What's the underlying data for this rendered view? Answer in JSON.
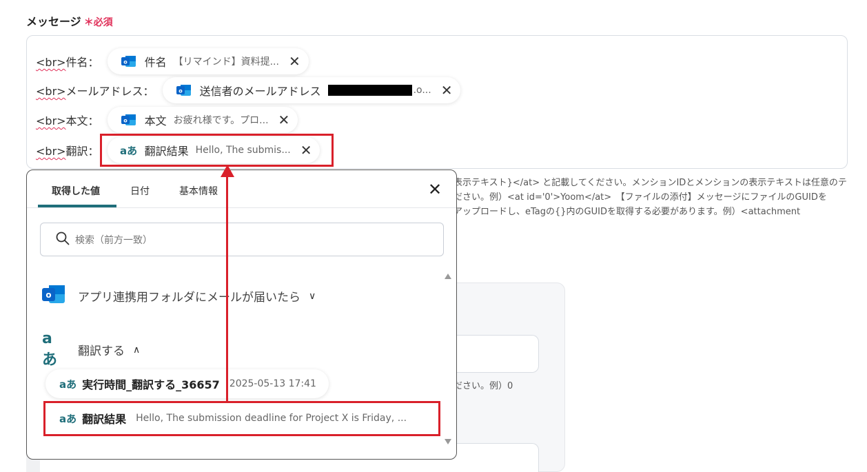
{
  "field": {
    "label": "メッセージ",
    "required_mark": "＊",
    "required_text": "必須"
  },
  "editor_rows": [
    {
      "prefix_tag": "<br>",
      "prefix_text": "件名：",
      "chip_name": "件名",
      "chip_value": "【リマインド】資料提...",
      "chip_icon": "outlook-icon"
    },
    {
      "prefix_tag": "<br>",
      "prefix_text": "メールアドレス：",
      "chip_name": "送信者のメールアドレス",
      "chip_value": ".o...",
      "chip_icon": "outlook-icon"
    },
    {
      "prefix_tag": "<br>",
      "prefix_text": "本文：",
      "chip_name": "本文",
      "chip_value": "お疲れ様です。プロ...",
      "chip_icon": "outlook-icon"
    },
    {
      "prefix_tag": "<br>",
      "prefix_text": "翻訳：",
      "chip_name": "翻訳結果",
      "chip_value": "Hello, The submis...",
      "chip_icon": "translate-icon"
    }
  ],
  "helper": {
    "line1": "表示テキスト}</at> と記載してください。メンションIDとメンションの表示テキストは任意のテ",
    "line2": "ださい。例）<at id='0'>Yoom</at>　【ファイルの添付】メッセージにファイルのGUIDを",
    "line3": "アップロードし、eTagの{}内のGUIDを取得する必要があります。例）<attachment",
    "line4": "ださい。例）0"
  },
  "popup": {
    "tabs": [
      "取得した値",
      "日付",
      "基本情報"
    ],
    "active_tab": 0,
    "search_placeholder": "検索（前方一致）",
    "groups": [
      {
        "title": "アプリ連携用フォルダにメールが届いたら",
        "icon": "outlook-icon",
        "chevron": "∨"
      },
      {
        "title": "翻訳する",
        "icon": "translate-icon",
        "chevron": "∧"
      }
    ],
    "items": [
      {
        "name": "実行時間_翻訳する_36657",
        "value": "2025-05-13 17:41"
      },
      {
        "name": "翻訳結果",
        "value": "Hello, The submission deadline for Project X is Friday, ..."
      }
    ]
  },
  "colors": {
    "accent": "#1f6e7a",
    "highlight": "#d9202a",
    "required": "#e0315a",
    "outlook": "#0a64c8"
  }
}
